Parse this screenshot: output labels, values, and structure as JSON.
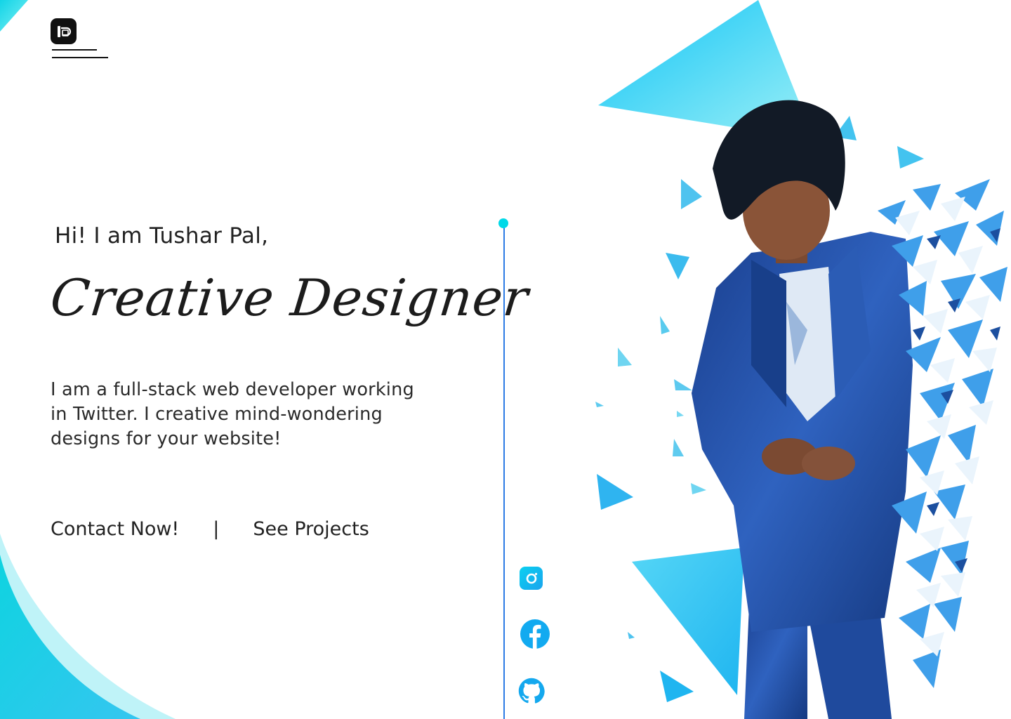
{
  "brand": {
    "logo_icon": "tp-logo-icon"
  },
  "nav": {
    "menu_icon": "hamburger-menu-icon"
  },
  "hero": {
    "greeting": "Hi! I am Tushar Pal,",
    "role": "Creative Designer",
    "bio": "I am a full-stack web developer working in Twitter. I creative mind-wondering designs for your website!",
    "cta_contact": "Contact Now!",
    "cta_separator": "|",
    "cta_projects": "See Projects"
  },
  "social": [
    {
      "name": "instagram",
      "icon": "instagram-icon"
    },
    {
      "name": "facebook",
      "icon": "facebook-icon"
    },
    {
      "name": "github",
      "icon": "github-icon"
    }
  ],
  "colors": {
    "accent_cyan": "#00d9e8",
    "accent_blue": "#2c7be5",
    "text": "#1f1f1f",
    "suit_blue": "#1e4fa5"
  }
}
